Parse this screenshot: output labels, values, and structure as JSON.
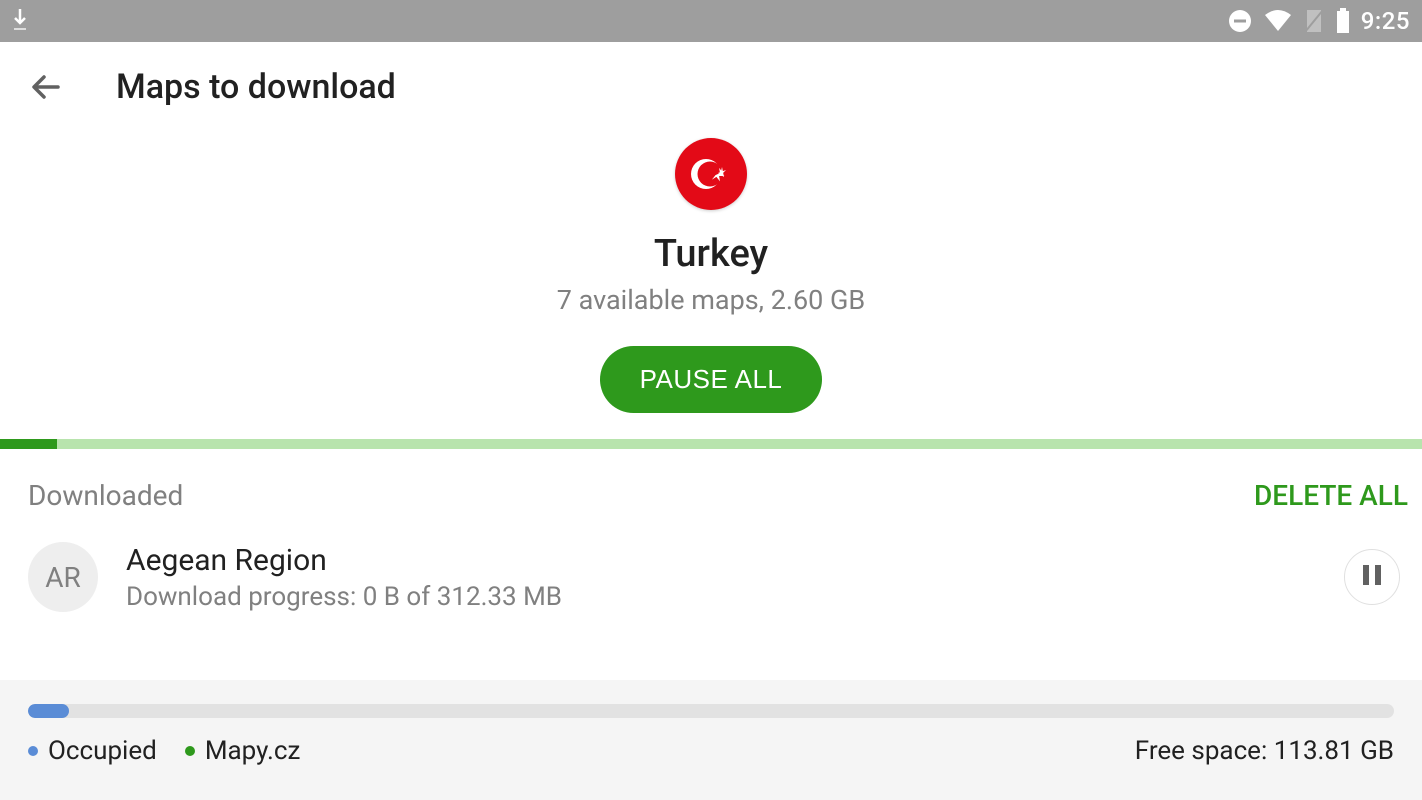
{
  "status_bar": {
    "time": "9:25"
  },
  "header": {
    "title": "Maps to download"
  },
  "hero": {
    "country": "Turkey",
    "subtitle": "7 available maps, 2.60 GB",
    "pause_all_label": "PAUSE ALL"
  },
  "overall_progress_percent": 4,
  "section": {
    "label": "Downloaded",
    "delete_all_label": "DELETE ALL"
  },
  "items": [
    {
      "avatar": "AR",
      "title": "Aegean Region",
      "subtitle": "Download progress: 0 B of 312.33 MB"
    }
  ],
  "storage": {
    "occupied_percent": 3,
    "legend_occupied": "Occupied",
    "legend_app": "Mapy.cz",
    "free_space": "Free space: 113.81 GB"
  }
}
